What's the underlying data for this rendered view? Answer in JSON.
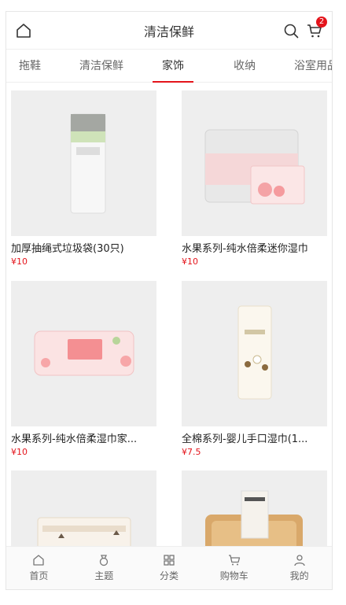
{
  "header": {
    "title": "清洁保鲜",
    "cart_badge": "2",
    "icons": [
      "home-icon",
      "search-icon",
      "cart-icon"
    ]
  },
  "tabs": [
    {
      "label": "拖鞋"
    },
    {
      "label": "清洁保鲜"
    },
    {
      "label": "家饰"
    },
    {
      "label": "收纳"
    },
    {
      "label": "浴室用品"
    }
  ],
  "products": [
    {
      "name": "加厚抽绳式垃圾袋(30只)",
      "price": "¥10"
    },
    {
      "name": "水果系列-纯水倍柔迷你湿巾",
      "price": "¥10"
    },
    {
      "name": "水果系列-纯水倍柔湿巾家...",
      "price": "¥10"
    },
    {
      "name": "全棉系列-婴儿手口湿巾(1...",
      "price": "¥7.5"
    }
  ],
  "bottom_nav": [
    {
      "label": "首页",
      "icon": "home-icon"
    },
    {
      "label": "主题",
      "icon": "theme-icon"
    },
    {
      "label": "分类",
      "icon": "category-icon"
    },
    {
      "label": "购物车",
      "icon": "cart-icon"
    },
    {
      "label": "我的",
      "icon": "user-icon"
    }
  ],
  "colors": {
    "accent": "#e4141b",
    "thumb_bg": "#eeeeee"
  }
}
